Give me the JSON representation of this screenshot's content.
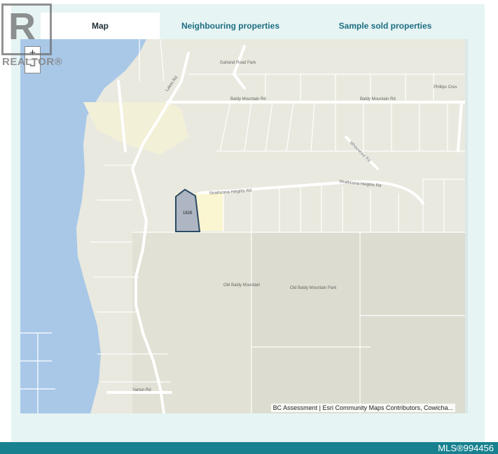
{
  "tabs": [
    {
      "label": "Map",
      "active": true
    },
    {
      "label": "Neighbouring properties",
      "active": false
    },
    {
      "label": "Sample sold properties",
      "active": false
    }
  ],
  "zoom": {
    "in_label": "+",
    "out_label": "−"
  },
  "logo": {
    "letter": "R",
    "word": "REALTOR®"
  },
  "map": {
    "attribution": "BC Assessment | Esri Community Maps Contributors, Cowicha...",
    "lot_number": "1828",
    "labels": {
      "garland_park": "Garland Road Park",
      "baldy_mountain_rd": "Baldy Mountain Rd",
      "strathcona_heights": "Strathcona Heights Rd",
      "old_baldy_mountain": "Old Baldy Mountain",
      "old_baldy_park": "Old Baldy Mountain Park",
      "lakes_rd": "Lakes Rd",
      "yarton_rd": "Yarton Rd",
      "phillips_cres": "Phillips Cres",
      "whitewood_rd": "Whitewood Rd"
    },
    "colors": {
      "water": "#a9c8e8",
      "land": "#e9e9df",
      "lot": "#adb6c2",
      "lot_border": "#2c4a63",
      "park": "#fbf6d2"
    }
  },
  "footer": {
    "mls": "MLS®994456"
  }
}
